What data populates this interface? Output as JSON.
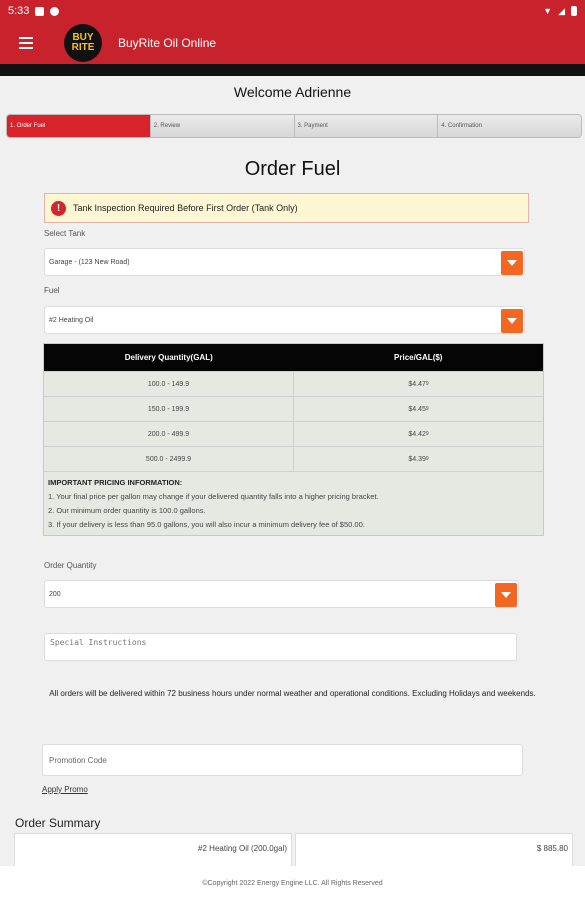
{
  "status_bar": {
    "time": "5:33"
  },
  "app_bar": {
    "logo_top": "BUY",
    "logo_bottom": "RITE",
    "title": "BuyRite Oil Online"
  },
  "welcome": "Welcome Adrienne",
  "steps": [
    {
      "label": "1. Order Fuel",
      "active": true
    },
    {
      "label": "2. Review",
      "active": false
    },
    {
      "label": "3. Payment",
      "active": false
    },
    {
      "label": "4. Confirmation",
      "active": false
    }
  ],
  "page_title": "Order Fuel",
  "alert": {
    "icon": "!",
    "text": "Tank Inspection Required Before First Order (Tank Only)"
  },
  "tank": {
    "label": "Select Tank",
    "value": "Garage - (123 New Road)"
  },
  "fuel": {
    "label": "Fuel",
    "value": "#2 Heating Oil"
  },
  "pricing": {
    "headers": [
      "Delivery Quantity(GAL)",
      "Price/GAL($)"
    ],
    "rows": [
      {
        "range": "100.0 - 149.9",
        "price": "$4.47",
        "sup": "9"
      },
      {
        "range": "150.0 - 199.9",
        "price": "$4.45",
        "sup": "9"
      },
      {
        "range": "200.0 - 499.9",
        "price": "$4.42",
        "sup": "9"
      },
      {
        "range": "500.0 - 2499.9",
        "price": "$4.39",
        "sup": "9"
      }
    ],
    "notes_title": "IMPORTANT PRICING INFORMATION:",
    "notes": [
      "1. Your final price per gallon may change if your delivered quantity falls into a higher pricing bracket.",
      "2. Our minimum order quantity is 100.0 gallons.",
      "3. If your delivery is less than 95.0 gallons, you will also incur a minimum delivery fee of $50.00."
    ]
  },
  "order_quantity": {
    "label": "Order Quantity",
    "value": "200"
  },
  "special_instructions": {
    "placeholder": "Special Instructions"
  },
  "delivery_note": "All orders will be delivered within 72 business hours under normal weather and operational conditions. Excluding Holidays and weekends.",
  "promo": {
    "placeholder": "Promotion Code",
    "apply_label": "Apply Promo"
  },
  "summary": {
    "title": "Order Summary",
    "item": "#2 Heating Oil (200.0gal)",
    "amount": "$ 885.80"
  },
  "footer": "©Copyright 2022 Energy Engine LLC. All Rights Reserved",
  "colors": {
    "brand_red": "#c8232c",
    "accent_orange": "#f26722",
    "alert_bg": "#fdf6d3"
  }
}
